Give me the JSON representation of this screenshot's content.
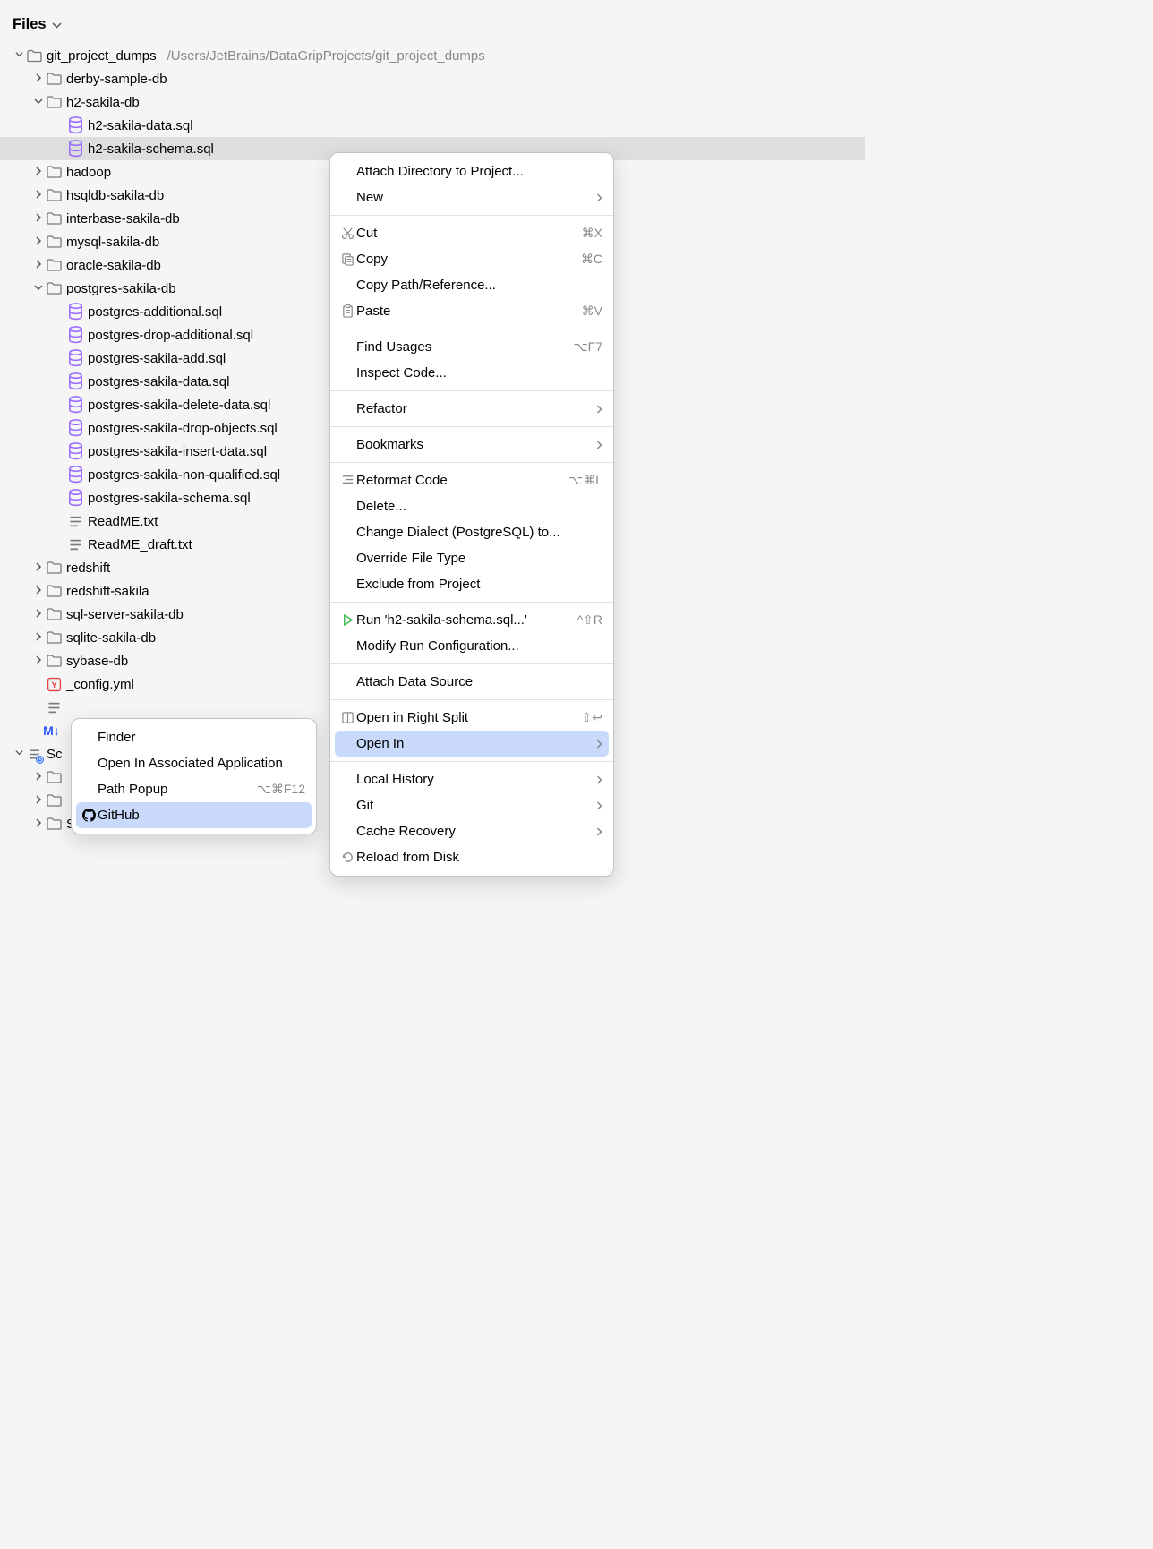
{
  "header": {
    "title": "Files"
  },
  "tree": {
    "root": {
      "name": "git_project_dumps",
      "path": "/Users/JetBrains/DataGripProjects/git_project_dumps"
    },
    "items": [
      {
        "indent": 1,
        "toggle": ">",
        "icon": "folder",
        "label": "derby-sample-db"
      },
      {
        "indent": 1,
        "toggle": "v",
        "icon": "folder",
        "label": "h2-sakila-db"
      },
      {
        "indent": 2,
        "toggle": "",
        "icon": "db",
        "label": "h2-sakila-data.sql"
      },
      {
        "indent": 2,
        "toggle": "",
        "icon": "db",
        "label": "h2-sakila-schema.sql",
        "selected": true
      },
      {
        "indent": 1,
        "toggle": ">",
        "icon": "folder",
        "label": "hadoop"
      },
      {
        "indent": 1,
        "toggle": ">",
        "icon": "folder",
        "label": "hsqldb-sakila-db"
      },
      {
        "indent": 1,
        "toggle": ">",
        "icon": "folder",
        "label": "interbase-sakila-db"
      },
      {
        "indent": 1,
        "toggle": ">",
        "icon": "folder",
        "label": "mysql-sakila-db"
      },
      {
        "indent": 1,
        "toggle": ">",
        "icon": "folder",
        "label": "oracle-sakila-db"
      },
      {
        "indent": 1,
        "toggle": "v",
        "icon": "folder",
        "label": "postgres-sakila-db"
      },
      {
        "indent": 2,
        "toggle": "",
        "icon": "db",
        "label": "postgres-additional.sql"
      },
      {
        "indent": 2,
        "toggle": "",
        "icon": "db",
        "label": "postgres-drop-additional.sql"
      },
      {
        "indent": 2,
        "toggle": "",
        "icon": "db",
        "label": "postgres-sakila-add.sql"
      },
      {
        "indent": 2,
        "toggle": "",
        "icon": "db",
        "label": "postgres-sakila-data.sql"
      },
      {
        "indent": 2,
        "toggle": "",
        "icon": "db",
        "label": "postgres-sakila-delete-data.sql"
      },
      {
        "indent": 2,
        "toggle": "",
        "icon": "db",
        "label": "postgres-sakila-drop-objects.sql"
      },
      {
        "indent": 2,
        "toggle": "",
        "icon": "db",
        "label": "postgres-sakila-insert-data.sql"
      },
      {
        "indent": 2,
        "toggle": "",
        "icon": "db",
        "label": "postgres-sakila-non-qualified.sql"
      },
      {
        "indent": 2,
        "toggle": "",
        "icon": "db",
        "label": "postgres-sakila-schema.sql"
      },
      {
        "indent": 2,
        "toggle": "",
        "icon": "text",
        "label": "ReadME.txt"
      },
      {
        "indent": 2,
        "toggle": "",
        "icon": "text",
        "label": "ReadME_draft.txt"
      },
      {
        "indent": 1,
        "toggle": ">",
        "icon": "folder",
        "label": "redshift"
      },
      {
        "indent": 1,
        "toggle": ">",
        "icon": "folder",
        "label": "redshift-sakila"
      },
      {
        "indent": 1,
        "toggle": ">",
        "icon": "folder",
        "label": "sql-server-sakila-db"
      },
      {
        "indent": 1,
        "toggle": ">",
        "icon": "folder",
        "label": "sqlite-sakila-db"
      },
      {
        "indent": 1,
        "toggle": ">",
        "icon": "folder",
        "label": "sybase-db"
      },
      {
        "indent": 1,
        "toggle": "",
        "icon": "yml",
        "label": "_config.yml"
      },
      {
        "indent": 1,
        "toggle": "",
        "icon": "text",
        "label": " "
      },
      {
        "indent": 1,
        "toggle": "",
        "icon": "md",
        "label": " "
      }
    ],
    "scratches_header": "Scratches and Consoles",
    "scratches_items": [
      {
        "indent": 1,
        "toggle": ">",
        "icon": "folder",
        "label": " "
      },
      {
        "indent": 1,
        "toggle": ">",
        "icon": "folder",
        "label": " "
      },
      {
        "indent": 1,
        "toggle": ">",
        "icon": "folder",
        "label": "Scratches"
      }
    ]
  },
  "context_menu": {
    "items": [
      {
        "type": "item",
        "label": "Attach Directory to Project..."
      },
      {
        "type": "item",
        "label": "New",
        "arrow": true
      },
      {
        "type": "divider"
      },
      {
        "type": "item",
        "icon": "scissors",
        "label": "Cut",
        "shortcut": "⌘X"
      },
      {
        "type": "item",
        "icon": "copy",
        "label": "Copy",
        "shortcut": "⌘C"
      },
      {
        "type": "item",
        "label": "Copy Path/Reference..."
      },
      {
        "type": "item",
        "icon": "paste",
        "label": "Paste",
        "shortcut": "⌘V"
      },
      {
        "type": "divider"
      },
      {
        "type": "item",
        "label": "Find Usages",
        "shortcut": "⌥F7"
      },
      {
        "type": "item",
        "label": "Inspect Code..."
      },
      {
        "type": "divider"
      },
      {
        "type": "item",
        "label": "Refactor",
        "arrow": true
      },
      {
        "type": "divider"
      },
      {
        "type": "item",
        "label": "Bookmarks",
        "arrow": true
      },
      {
        "type": "divider"
      },
      {
        "type": "item",
        "icon": "reformat",
        "label": "Reformat Code",
        "shortcut": "⌥⌘L"
      },
      {
        "type": "item",
        "label": "Delete...",
        "icon_right": "del"
      },
      {
        "type": "item",
        "label": "Change Dialect (PostgreSQL) to..."
      },
      {
        "type": "item",
        "label": "Override File Type"
      },
      {
        "type": "item",
        "label": "Exclude from Project"
      },
      {
        "type": "divider"
      },
      {
        "type": "item",
        "icon": "run",
        "label": "Run 'h2-sakila-schema.sql...'",
        "shortcut": "^⇧R"
      },
      {
        "type": "item",
        "label": "Modify Run Configuration..."
      },
      {
        "type": "divider"
      },
      {
        "type": "item",
        "label": "Attach Data Source"
      },
      {
        "type": "divider"
      },
      {
        "type": "item",
        "icon": "split",
        "label": "Open in Right Split",
        "shortcut": "⇧↩"
      },
      {
        "type": "item",
        "label": "Open In",
        "arrow": true,
        "highlighted": true
      },
      {
        "type": "divider"
      },
      {
        "type": "item",
        "label": "Local History",
        "arrow": true
      },
      {
        "type": "item",
        "label": "Git",
        "arrow": true
      },
      {
        "type": "item",
        "label": "Cache Recovery",
        "arrow": true
      },
      {
        "type": "item",
        "icon": "reload",
        "label": "Reload from Disk"
      }
    ]
  },
  "submenu": {
    "items": [
      {
        "label": "Finder"
      },
      {
        "label": "Open In Associated Application"
      },
      {
        "label": "Path Popup",
        "shortcut": "⌥⌘F12"
      },
      {
        "icon": "github",
        "label": "GitHub",
        "highlighted": true
      }
    ]
  }
}
